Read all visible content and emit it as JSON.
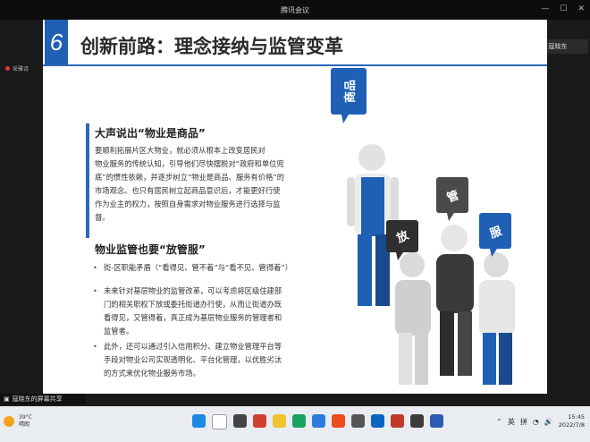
{
  "window": {
    "title": "腾讯会议"
  },
  "left_panel": {
    "speaker_label": "采雅诗"
  },
  "speaking": {
    "label": "正在讲话: 寇晓东"
  },
  "slide": {
    "number": "6",
    "title": "创新前路：理念接纳与监管变革",
    "section1": {
      "heading": "大声说出“物业是商品”",
      "lines": [
        "要顺利拓展片区大物业，就必须从根本上改变居民对",
        "物业服务的传统认知，引导他们尽快摆脱对“政府和单位兜",
        "底”的惯性依赖，并逐步树立“物业是商品、服务有价格”的",
        "市场观念。也只有居民树立起商品意识后，才能更好行使",
        "作为业主的权力，按照自身需求对物业服务进行选择与监",
        "督。"
      ]
    },
    "section2": {
      "heading": "物业监管也要“放管服”",
      "bullet1": "街-区职能矛盾（“看得见、管不着”与“看不见、管得着”）",
      "bullet2_lines": [
        "未来针对基层物业的监管改革，可以考虑将区级住建部",
        "门的相关职权下放或委托街道办行使，从而让街道办既",
        "看得见，又管得着，真正成为基层物业服务的管理者和",
        "监管者。"
      ],
      "bullet3_lines": [
        "此外，还可以通过引入信用积分、建立物业管理平台等",
        "手段对物业公司实现透明化、平台化管理，以优胜劣汰",
        "的方式来优化物业服务市场。"
      ]
    },
    "bubbles": [
      "商品",
      "放",
      "管",
      "服"
    ],
    "colors": {
      "accent": "#1f5fb4",
      "dark": "#3a3a3a",
      "light": "#d9d9d9"
    }
  },
  "share_label": "寇晓东的屏幕共享",
  "taskbar": {
    "weather_temp": "39°C",
    "weather_desc": "晴朗",
    "tray_lang": "英",
    "tray_ime": "拼",
    "time": "15:45",
    "date": "2022/7/8"
  }
}
